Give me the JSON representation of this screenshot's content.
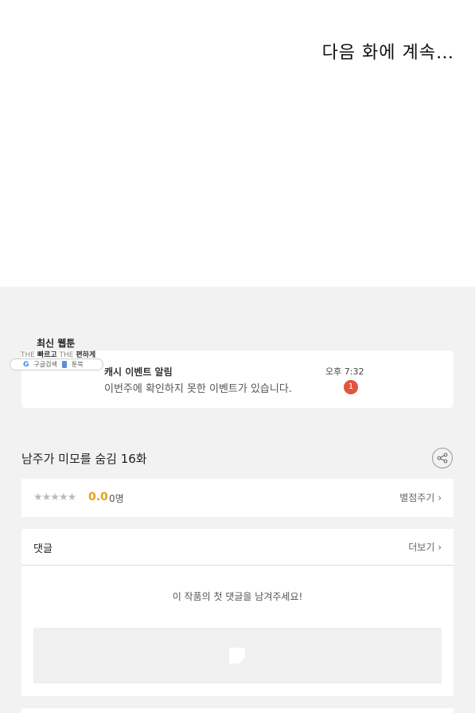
{
  "comic": {
    "caption": "다음 화에 계속…"
  },
  "promo": {
    "title": "최신 웹툰",
    "sub_prefix1": "THE ",
    "sub_word1": "빠르고",
    "sub_prefix2": " THE ",
    "sub_word2": "편하게",
    "pill_search": "구글검색",
    "pill_brand": "툰북"
  },
  "notification": {
    "title": "캐시 이벤트 알림",
    "message": "이번주에 확인하지 못한 이벤트가 있습니다.",
    "time": "오후 7:32",
    "badge_count": "1"
  },
  "episode": {
    "title": "남주가 미모를 숨김 16화"
  },
  "rating": {
    "stars": "★★★★★",
    "score": "0.0",
    "count": "0명",
    "rate_link": "별점주기"
  },
  "comments": {
    "title": "댓글",
    "more_link": "더보기",
    "empty_message": "이 작품의 첫 댓글을 남겨주세요!"
  },
  "colors": {
    "accent": "#e6a214",
    "badge": "#e2553f",
    "background": "#f2f2f2"
  }
}
